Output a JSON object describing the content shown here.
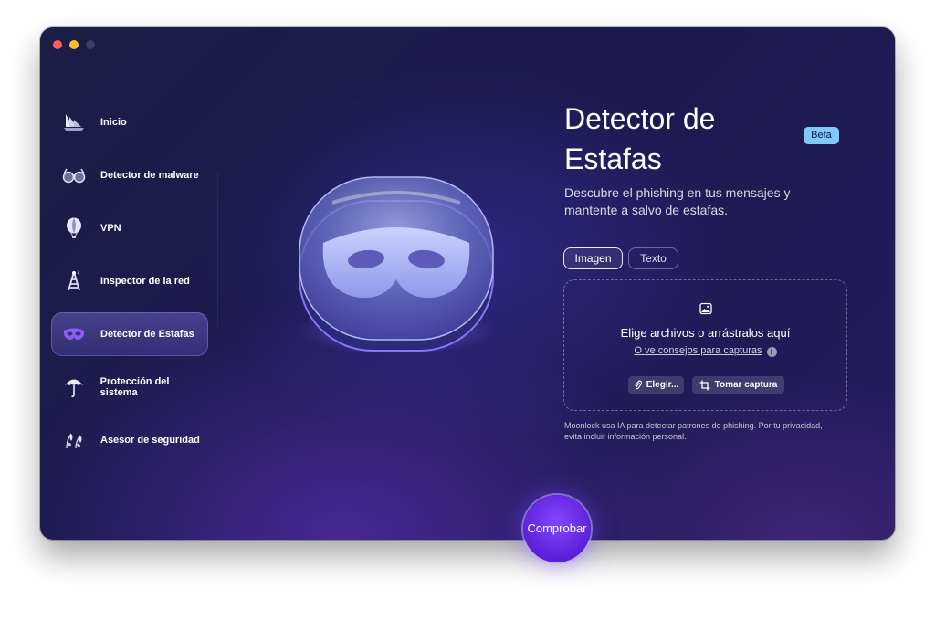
{
  "sidebar": {
    "items": [
      {
        "label": "Inicio",
        "icon": "home-ship-icon"
      },
      {
        "label": "Detector de malware",
        "icon": "glasses-icon"
      },
      {
        "label": "VPN",
        "icon": "balloon-icon"
      },
      {
        "label": "Inspector de la red",
        "icon": "tower-icon"
      },
      {
        "label": "Detector de Estafas",
        "icon": "mask-icon",
        "active": true
      },
      {
        "label": "Protección del sistema",
        "icon": "umbrella-icon"
      },
      {
        "label": "Asesor de seguridad",
        "icon": "leaves-icon"
      }
    ]
  },
  "main": {
    "title_line1": "Detector de",
    "title_line2": "Estafas",
    "badge": "Beta",
    "subtitle_line1": "Descubre el phishing en tus mensajes y",
    "subtitle_line2": "mantente a salvo de estafas.",
    "tabs": [
      "Imagen",
      "Texto"
    ],
    "dropzone": {
      "title": "Elige archivos o arrástralos aquí",
      "link": "O ve consejos para capturas",
      "choose_button": "Elegir...",
      "capture_button": "Tomar captura"
    },
    "privacy_line1": "Moonlock usa IA para detectar patrones de phishing. Por tu privacidad,",
    "privacy_line2": "evita incluir información personal.",
    "check_button": "Comprobar"
  },
  "colors": {
    "accent": "#6a2cf0",
    "badge": "#7ec9ff",
    "close": "#ff5f57",
    "minimize": "#febc2e"
  }
}
